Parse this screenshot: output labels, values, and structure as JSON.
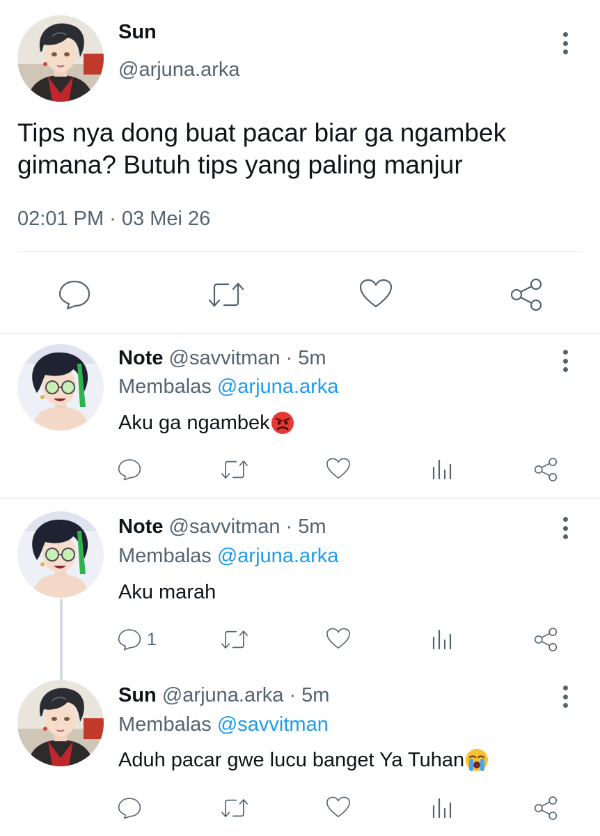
{
  "main_tweet": {
    "name": "Sun",
    "handle": "@arjuna.arka",
    "text_line1": "Tips nya dong buat pacar biar ga ngambek",
    "text_line2": "gimana? Butuh tips yang paling manjur",
    "timestamp": "02:01 PM · 03 Mei 26",
    "avatar_icon": "avatar-sun",
    "actions": [
      "reply-icon",
      "retweet-icon",
      "like-icon",
      "share-icon"
    ]
  },
  "replies": [
    {
      "name": "Note",
      "handle": "@savvitman",
      "sep": "·",
      "time": "5m",
      "replying_prefix": "Membalas",
      "replying_to": "@arjuna.arka",
      "text": "Aku ga ngambek",
      "emoji": "angry-face-emoji",
      "reply_count": "",
      "avatar_icon": "avatar-note"
    },
    {
      "name": "Note",
      "handle": "@savvitman",
      "sep": "·",
      "time": "5m",
      "replying_prefix": "Membalas",
      "replying_to": "@arjuna.arka",
      "text": "Aku marah",
      "emoji": "",
      "reply_count": "1",
      "avatar_icon": "avatar-note"
    },
    {
      "name": "Sun",
      "handle": "@arjuna.arka",
      "sep": "·",
      "time": "5m",
      "replying_prefix": "Membalas",
      "replying_to": "@savvitman",
      "text": "Aduh pacar gwe lucu banget Ya Tuhan",
      "emoji": "loudly-crying-face-emoji",
      "reply_count": "",
      "avatar_icon": "avatar-sun"
    }
  ],
  "colors": {
    "text": "#0f1419",
    "secondary": "#536471",
    "link": "#1d9bf0",
    "divider": "#e1e4e8"
  }
}
